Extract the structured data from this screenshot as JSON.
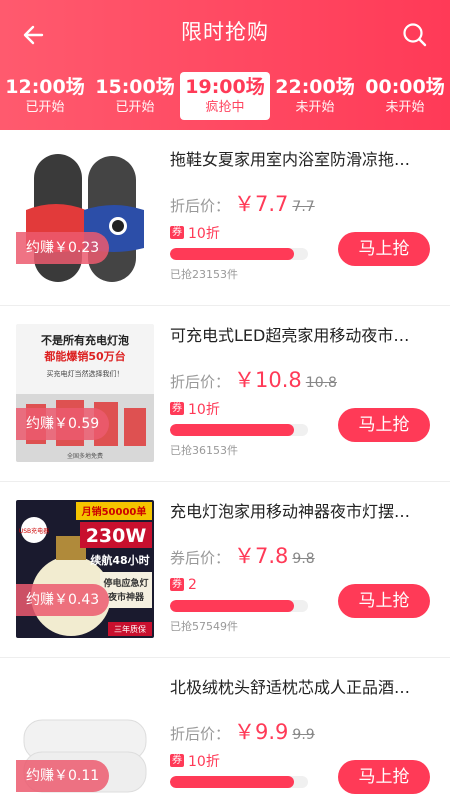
{
  "header": {
    "title": "限时抢购",
    "tabs": [
      {
        "time": "12:00场",
        "status": "已开始",
        "active": false
      },
      {
        "time": "15:00场",
        "status": "已开始",
        "active": false
      },
      {
        "time": "19:00场",
        "status": "疯抢中",
        "active": true
      },
      {
        "time": "22:00场",
        "status": "未开始",
        "active": false
      },
      {
        "time": "00:00场",
        "status": "未开始",
        "active": false
      }
    ]
  },
  "items": [
    {
      "name": "拖鞋女夏家用室内浴室防滑凉拖…",
      "earn": "约赚￥0.23",
      "price_label": "折后价：",
      "price": "￥7.7",
      "old_price": "7.7",
      "coupon_tag": "券",
      "coupon_value": "10折",
      "progress": 0.9,
      "sold": "已抢23153件",
      "button": "马上抢"
    },
    {
      "name": "可充电式LED超亮家用移动夜市…",
      "earn": "约赚￥0.59",
      "price_label": "折后价：",
      "price": "￥10.8",
      "old_price": "10.8",
      "coupon_tag": "券",
      "coupon_value": "10折",
      "progress": 0.9,
      "sold": "已抢36153件",
      "button": "马上抢",
      "image_text": [
        "不是所有充电灯泡",
        "都能爆销50万台",
        "买充电灯当然选择我们！",
        "全国多地免费"
      ]
    },
    {
      "name": "充电灯泡家用移动神器夜市灯摆…",
      "earn": "约赚￥0.43",
      "price_label": "券后价：",
      "price": "￥7.8",
      "old_price": "9.8",
      "coupon_tag": "券",
      "coupon_value": "2",
      "progress": 0.9,
      "sold": "已抢57549件",
      "button": "马上抢",
      "image_text": [
        "月销50000单",
        "230W",
        "续航48小时",
        "停电应急灯",
        "夜市神器",
        "三年质保",
        "USB充电器"
      ]
    },
    {
      "name": "北极绒枕头舒适枕芯成人正品酒…",
      "earn": "约赚￥0.11",
      "price_label": "折后价：",
      "price": "￥9.9",
      "old_price": "9.9",
      "coupon_tag": "券",
      "coupon_value": "10折",
      "progress": 0.9,
      "sold": "",
      "button": "马上抢"
    }
  ],
  "colors": {
    "accent": "#ff3a57",
    "header_start": "#ff5a6e"
  },
  "icons": {
    "back": "back-arrow-icon",
    "search": "search-icon"
  }
}
